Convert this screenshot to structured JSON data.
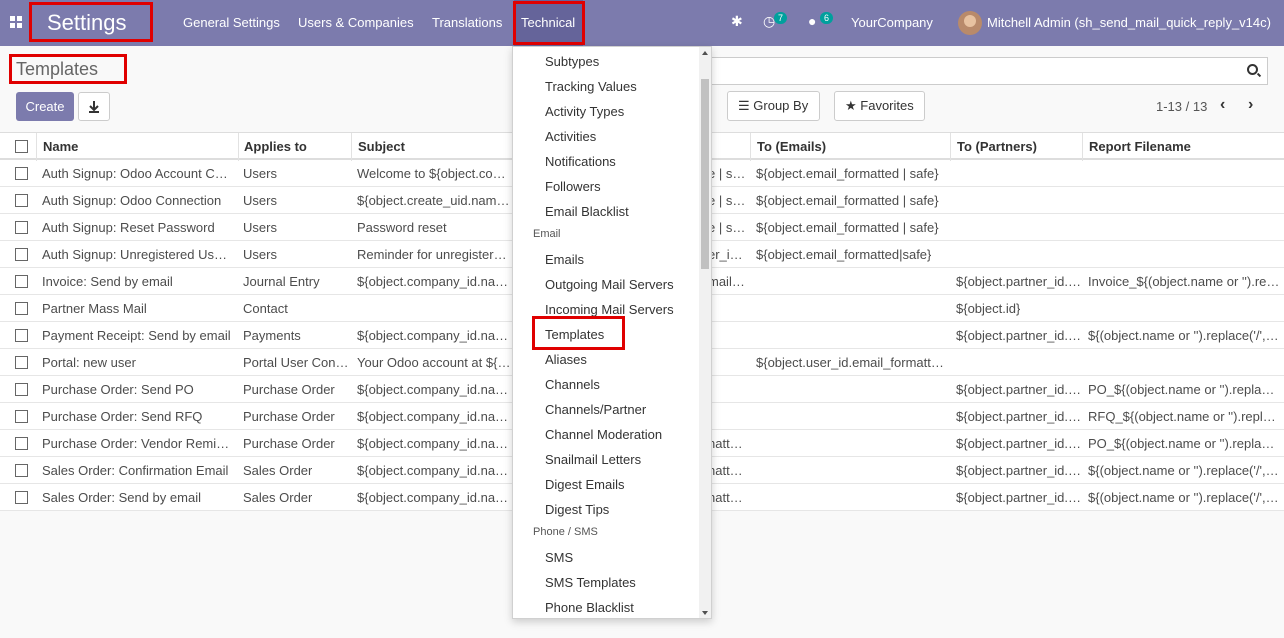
{
  "navbar": {
    "app_name": "Settings",
    "menu": [
      "General Settings",
      "Users & Companies",
      "Translations",
      "Technical"
    ],
    "activity_count": "7",
    "message_count": "6",
    "company": "YourCompany",
    "user": "Mitchell Admin (sh_send_mail_quick_reply_v14c)"
  },
  "control_panel": {
    "breadcrumb": "Templates",
    "create_label": "Create",
    "group_by_label": "Group By",
    "favorites_label": "Favorites",
    "pager": "1-13 / 13"
  },
  "table": {
    "columns": [
      "Name",
      "Applies to",
      "Subject",
      "To (Emails)",
      "To (Partners)",
      "Report Filename"
    ],
    "rows": [
      {
        "name": "Auth Signup: Odoo Account Cr…",
        "applies": "Users",
        "subject": "Welcome to ${object.compa",
        "frag": "e | s…",
        "to_emails": "${object.email_formatted | safe}",
        "to_partners": "",
        "report": ""
      },
      {
        "name": "Auth Signup: Odoo Connection",
        "applies": "Users",
        "subject": "${object.create_uid.name} f",
        "frag": "e | s…",
        "to_emails": "${object.email_formatted | safe}",
        "to_partners": "",
        "report": ""
      },
      {
        "name": "Auth Signup: Reset Password",
        "applies": "Users",
        "subject": "Password reset",
        "frag": "e | s…",
        "to_emails": "${object.email_formatted | safe}",
        "to_partners": "",
        "report": ""
      },
      {
        "name": "Auth Signup: Unregistered Users",
        "applies": "Users",
        "subject": "Reminder for unregistered u",
        "frag": "er_i…",
        "to_emails": "${object.email_formatted|safe}",
        "to_partners": "",
        "report": ""
      },
      {
        "name": "Invoice: Send by email",
        "applies": "Journal Entry",
        "subject": "${object.company_id.name",
        "frag": "mail…",
        "to_emails": "",
        "to_partners": "${object.partner_id.id}",
        "report": "Invoice_${(object.name or '').re…"
      },
      {
        "name": "Partner Mass Mail",
        "applies": "Contact",
        "subject": "",
        "frag": "",
        "to_emails": "",
        "to_partners": "${object.id}",
        "report": ""
      },
      {
        "name": "Payment Receipt: Send by email",
        "applies": "Payments",
        "subject": "${object.company_id.name",
        "frag": "",
        "to_emails": "",
        "to_partners": "${object.partner_id.id}",
        "report": "${(object.name or '').replace('/','…"
      },
      {
        "name": "Portal: new user",
        "applies": "Portal User Config",
        "subject": "Your Odoo account at ${obj",
        "frag": "",
        "to_emails": "${object.user_id.email_formatt…",
        "to_partners": "",
        "report": ""
      },
      {
        "name": "Purchase Order: Send PO",
        "applies": "Purchase Order",
        "subject": "${object.company_id.name",
        "frag": "",
        "to_emails": "",
        "to_partners": "${object.partner_id.id}",
        "report": "PO_${(object.name or '').replac…"
      },
      {
        "name": "Purchase Order: Send RFQ",
        "applies": "Purchase Order",
        "subject": "${object.company_id.name",
        "frag": "",
        "to_emails": "",
        "to_partners": "${object.partner_id.id}",
        "report": "RFQ_${(object.name or '').repl…"
      },
      {
        "name": "Purchase Order: Vendor Remin…",
        "applies": "Purchase Order",
        "subject": "${object.company_id.name",
        "frag": "natt…",
        "to_emails": "",
        "to_partners": "${object.partner_id.id}",
        "report": "PO_${(object.name or '').replac…"
      },
      {
        "name": "Sales Order: Confirmation Email",
        "applies": "Sales Order",
        "subject": "${object.company_id.name",
        "frag": "natt…",
        "to_emails": "",
        "to_partners": "${object.partner_id.id}",
        "report": "${(object.name or '').replace('/','…"
      },
      {
        "name": "Sales Order: Send by email",
        "applies": "Sales Order",
        "subject": "${object.company_id.name",
        "frag": "natt…",
        "to_emails": "",
        "to_partners": "${object.partner_id.id}",
        "report": "${(object.name or '').replace('/','…"
      }
    ]
  },
  "dropdown": [
    {
      "kind": "item",
      "label": "Subtypes"
    },
    {
      "kind": "item",
      "label": "Tracking Values"
    },
    {
      "kind": "item",
      "label": "Activity Types"
    },
    {
      "kind": "item",
      "label": "Activities"
    },
    {
      "kind": "item",
      "label": "Notifications"
    },
    {
      "kind": "item",
      "label": "Followers"
    },
    {
      "kind": "item",
      "label": "Email Blacklist"
    },
    {
      "kind": "header",
      "label": "Email"
    },
    {
      "kind": "item",
      "label": "Emails"
    },
    {
      "kind": "item",
      "label": "Outgoing Mail Servers"
    },
    {
      "kind": "item",
      "label": "Incoming Mail Servers"
    },
    {
      "kind": "item",
      "label": "Templates"
    },
    {
      "kind": "item",
      "label": "Aliases"
    },
    {
      "kind": "item",
      "label": "Channels"
    },
    {
      "kind": "item",
      "label": "Channels/Partner"
    },
    {
      "kind": "item",
      "label": "Channel Moderation"
    },
    {
      "kind": "item",
      "label": "Snailmail Letters"
    },
    {
      "kind": "item",
      "label": "Digest Emails"
    },
    {
      "kind": "item",
      "label": "Digest Tips"
    },
    {
      "kind": "header",
      "label": "Phone / SMS"
    },
    {
      "kind": "item",
      "label": "SMS"
    },
    {
      "kind": "item",
      "label": "SMS Templates"
    },
    {
      "kind": "item",
      "label": "Phone Blacklist"
    }
  ],
  "colors": {
    "navbar": "#7c7bad",
    "highlight": "#e00000",
    "badge": "#00a09d"
  }
}
